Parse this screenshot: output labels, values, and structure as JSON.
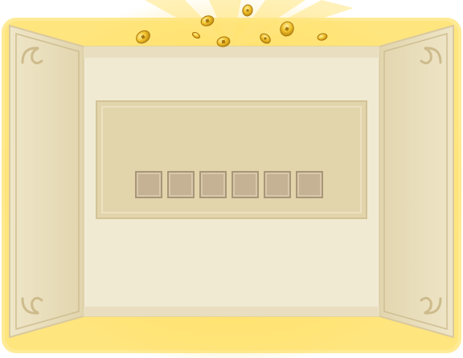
{
  "theme": {
    "glow": "#ffd93b",
    "panel_light": "#f1ead3",
    "panel_side": "#e6dbb8",
    "panel_border": "#d9c99f",
    "inner_panel": "#e2d4ab",
    "slot_fill": "#c5b193",
    "slot_border": "#a99677",
    "coin": "#e8b51e"
  },
  "code_entry": {
    "slot_count": 6,
    "slots": [
      "",
      "",
      "",
      "",
      "",
      ""
    ]
  },
  "decorations": {
    "coin_icon": "gold-coin-icon",
    "corner_icon": "scroll-corner-icon"
  }
}
